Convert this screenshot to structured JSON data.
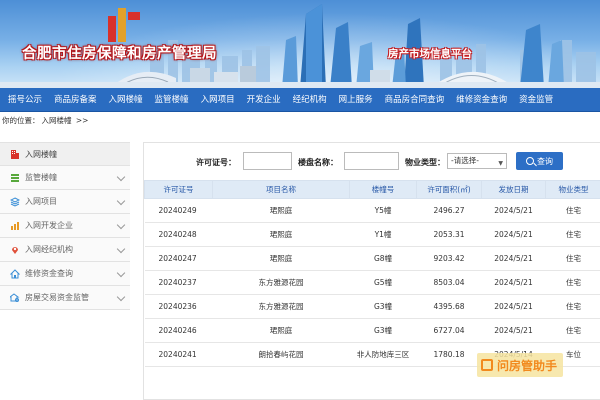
{
  "header": {
    "title": "合肥市住房保障和房产管理局",
    "subtitle": "房产市场信息平台"
  },
  "nav": {
    "items": [
      {
        "label": "摇号公示"
      },
      {
        "label": "商品房备案"
      },
      {
        "label": "入网楼幢"
      },
      {
        "label": "监管楼幢"
      },
      {
        "label": "入网项目"
      },
      {
        "label": "开发企业"
      },
      {
        "label": "经纪机构"
      },
      {
        "label": "网上服务"
      },
      {
        "label": "商品房合同查询"
      },
      {
        "label": "维修资金查询"
      },
      {
        "label": "资金监管"
      }
    ]
  },
  "breadcrumb": {
    "prefix": "你的位置：",
    "current": "入网楼幢",
    "sep": ">>"
  },
  "sidebar": {
    "items": [
      {
        "label": "入网楼幢",
        "icon": "building-icon"
      },
      {
        "label": "监管楼幢",
        "icon": "stack-icon"
      },
      {
        "label": "入网项目",
        "icon": "layers-icon"
      },
      {
        "label": "入网开发企业",
        "icon": "chart-icon"
      },
      {
        "label": "入网经纪机构",
        "icon": "pin-icon"
      },
      {
        "label": "维修资金查询",
        "icon": "house-icon"
      },
      {
        "label": "房屋交易资金监管",
        "icon": "house-search-icon"
      }
    ]
  },
  "filters": {
    "permit_label": "许可证号：",
    "permit_value": "",
    "name_label": "楼盘名称：",
    "name_value": "",
    "type_label": "物业类型：",
    "type_selected": "-请选择-",
    "search_label": "查询"
  },
  "table": {
    "headers": [
      "许可证号",
      "项目名称",
      "楼幢号",
      "许可面积(㎡)",
      "发放日期",
      "物业类型"
    ],
    "rows": [
      [
        "20240249",
        "珺熙庭",
        "Y5幢",
        "2496.27",
        "2024/5/21",
        "住宅"
      ],
      [
        "20240248",
        "珺熙庭",
        "Y1幢",
        "2053.31",
        "2024/5/21",
        "住宅"
      ],
      [
        "20240247",
        "珺熙庭",
        "G8幢",
        "9203.42",
        "2024/5/21",
        "住宅"
      ],
      [
        "20240237",
        "东方雅源花园",
        "G5幢",
        "8503.04",
        "2024/5/21",
        "住宅"
      ],
      [
        "20240236",
        "东方雅源花园",
        "G3幢",
        "4395.68",
        "2024/5/21",
        "住宅"
      ],
      [
        "20240246",
        "珺熙庭",
        "G3幢",
        "6727.04",
        "2024/5/21",
        "住宅"
      ],
      [
        "20240241",
        "朗拾春屿花园",
        "非人防地库三区",
        "1780.18",
        "2024/5/14",
        "车位"
      ]
    ]
  },
  "watermark": {
    "text": "问房管助手"
  },
  "colors": {
    "nav_bg": "#2a6cc1",
    "header_row_bg": "#dfeaf6",
    "accent": "#2d6fc6",
    "title_outline": "#b5161a"
  }
}
